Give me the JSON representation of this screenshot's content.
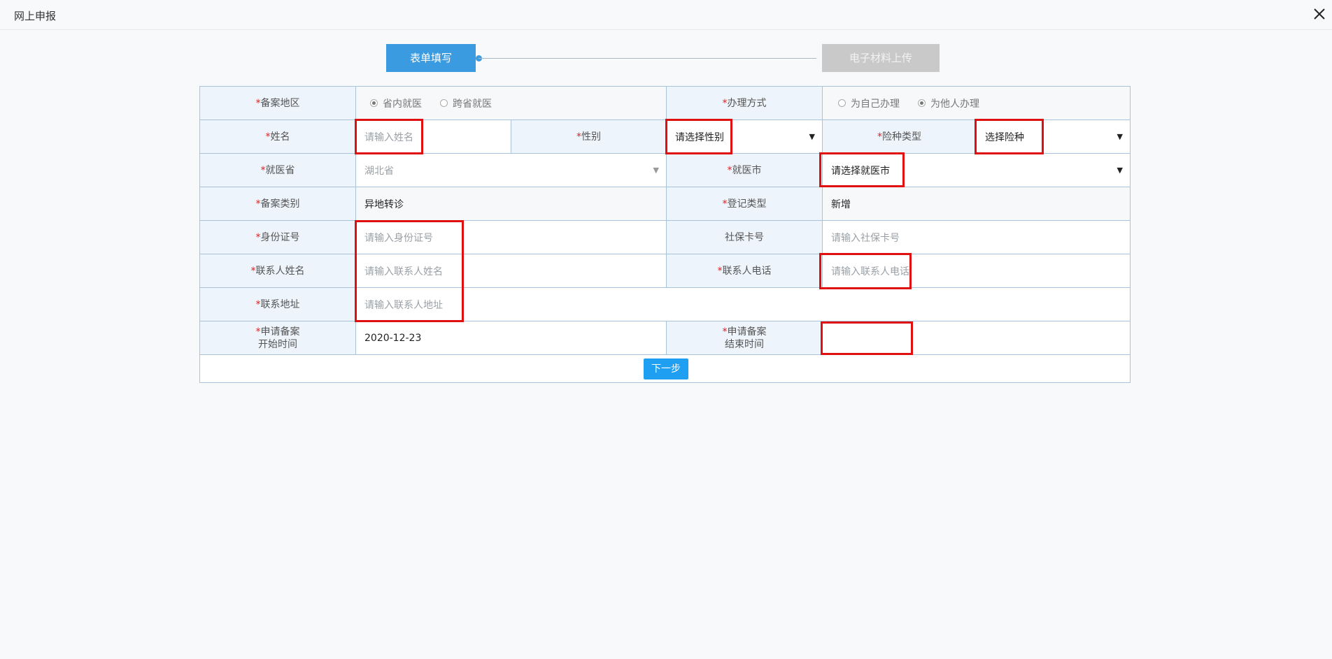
{
  "window": {
    "title": "网上申报",
    "close_icon": "close-icon"
  },
  "stepper": {
    "step1": "表单填写",
    "step2": "电子材料上传"
  },
  "form": {
    "required_mark": "*",
    "region_label": "备案地区",
    "region_options": [
      "省内就医",
      "跨省就医"
    ],
    "handle_label": "办理方式",
    "handle_options": [
      "为自己办理",
      "为他人办理"
    ],
    "name_label": "姓名",
    "name_placeholder": "请输入姓名",
    "gender_label": "性别",
    "gender_value": "请选择性别",
    "insurance_label": "险种类型",
    "insurance_value": "选择险种",
    "province_label": "就医省",
    "province_value": "湖北省",
    "city_label": "就医市",
    "city_value": "请选择就医市",
    "category_label": "备案类别",
    "category_value": "异地转诊",
    "reg_type_label": "登记类型",
    "reg_type_value": "新增",
    "id_label": "身份证号",
    "id_placeholder": "请输入身份证号",
    "ss_label": "社保卡号",
    "ss_placeholder": "请输入社保卡号",
    "contact_name_label": "联系人姓名",
    "contact_name_placeholder": "请输入联系人姓名",
    "contact_phone_label": "联系人电话",
    "contact_phone_placeholder": "请输入联系人电话",
    "address_label": "联系地址",
    "address_placeholder": "请输入联系人地址",
    "start_label_1": "申请备案",
    "start_label_2": "开始时间",
    "start_value": "2020-12-23",
    "end_label_1": "申请备案",
    "end_label_2": "结束时间",
    "end_value": ""
  },
  "actions": {
    "next": "下一步"
  }
}
